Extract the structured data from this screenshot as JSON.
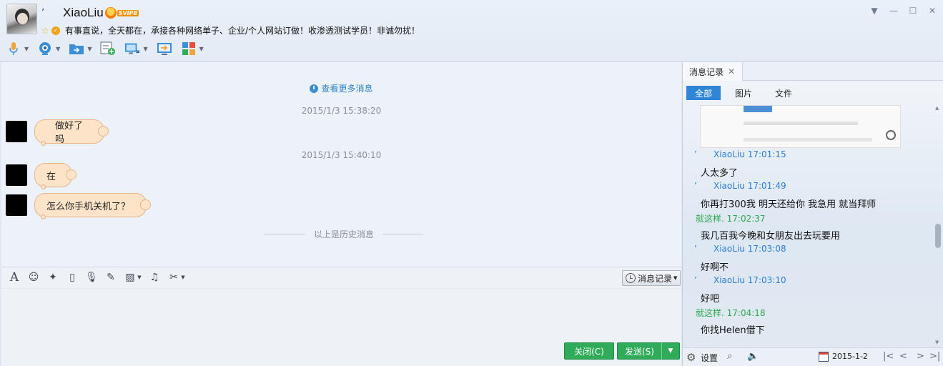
{
  "header": {
    "prefix": "’",
    "username": "XiaoLiu",
    "vip_label": "SVIP8",
    "signature": "有事直说，全天都在，承接各种网络单子、企业/个人网站订做！收渗透测试学员！非诚勿扰！"
  },
  "toolbar": {
    "items": [
      "microphone-icon",
      "camera-icon",
      "file-transfer-icon",
      "add-contact-icon",
      "screen-share-icon",
      "remote-assist-icon",
      "apps-icon"
    ]
  },
  "chat": {
    "more_history": "查看更多消息",
    "timestamps": [
      "2015/1/3 15:38:20",
      "2015/1/3 15:40:10"
    ],
    "messages": [
      "做好了吗",
      "在",
      "怎么你手机关机了？"
    ],
    "history_separator": "以上是历史消息"
  },
  "input_toolbar": {
    "history_button": "消息记录"
  },
  "buttons": {
    "close": "关闭(C)",
    "send": "发送(S)"
  },
  "right_panel": {
    "tab": "消息记录",
    "filters": [
      "全部",
      "图片",
      "文件"
    ],
    "active_filter": "全部",
    "entries": [
      {
        "type": "sender",
        "text": "XiaoLiu 17:01:15"
      },
      {
        "type": "text",
        "text": "人太多了"
      },
      {
        "type": "sender",
        "text": "XiaoLiu 17:01:49"
      },
      {
        "type": "text",
        "text": "你再打300我 明天还给你 我急用  就当拜师"
      },
      {
        "type": "self",
        "text": "就这样. 17:02:37"
      },
      {
        "type": "text",
        "text": "我几百我今晚和女朋友出去玩要用"
      },
      {
        "type": "sender",
        "text": "XiaoLiu 17:03:08"
      },
      {
        "type": "text",
        "text": "好啊不"
      },
      {
        "type": "sender",
        "text": "XiaoLiu 17:03:10"
      },
      {
        "type": "text",
        "text": "好吧"
      },
      {
        "type": "self",
        "text": "就这样. 17:04:18"
      },
      {
        "type": "text",
        "text": "你找Helen借下"
      }
    ],
    "settings": "设置",
    "date": "2015-1-2"
  },
  "colors": {
    "accent": "#2f86d6",
    "send_green": "#2fab5a",
    "bubble": "#fde3c8",
    "sender_blue": "#2b7ed0",
    "self_green": "#2aa64d"
  }
}
